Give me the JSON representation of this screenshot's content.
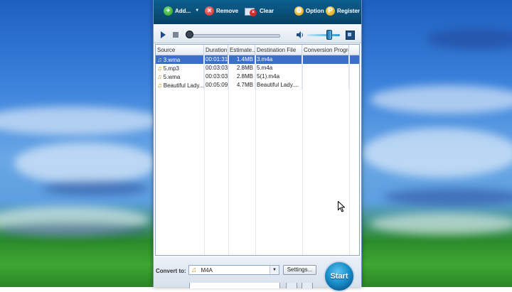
{
  "toolbar": {
    "add_label": "Add...",
    "remove_label": "Remove",
    "clear_label": "Clear",
    "option_label": "Option",
    "register_label": "Register"
  },
  "table": {
    "headers": [
      "Source",
      "Duration",
      "Estimate...",
      "Destination File",
      "Conversion Progress"
    ],
    "rows": [
      {
        "source": "3.wma",
        "duration": "00:01:31",
        "estimate": "1.4MB",
        "destination": "3.m4a",
        "progress": ""
      },
      {
        "source": "5.mp3",
        "duration": "00:03:03",
        "estimate": "2.8MB",
        "destination": "5.m4a",
        "progress": ""
      },
      {
        "source": "5.wma",
        "duration": "00:03:03",
        "estimate": "2.8MB",
        "destination": "5(1).m4a",
        "progress": ""
      },
      {
        "source": "Beautiful Lady....",
        "duration": "00:05:09",
        "estimate": "4.7MB",
        "destination": "Beautiful Lady....",
        "progress": ""
      }
    ]
  },
  "bottom": {
    "convert_label": "Convert to:",
    "format_value": "M4A",
    "settings_label": "Settings...",
    "start_label": "Start"
  },
  "colors": {
    "toolbar_bg": "#0a4f78",
    "selection": "#3b6fc9",
    "start_button": "#1b8fcb"
  }
}
